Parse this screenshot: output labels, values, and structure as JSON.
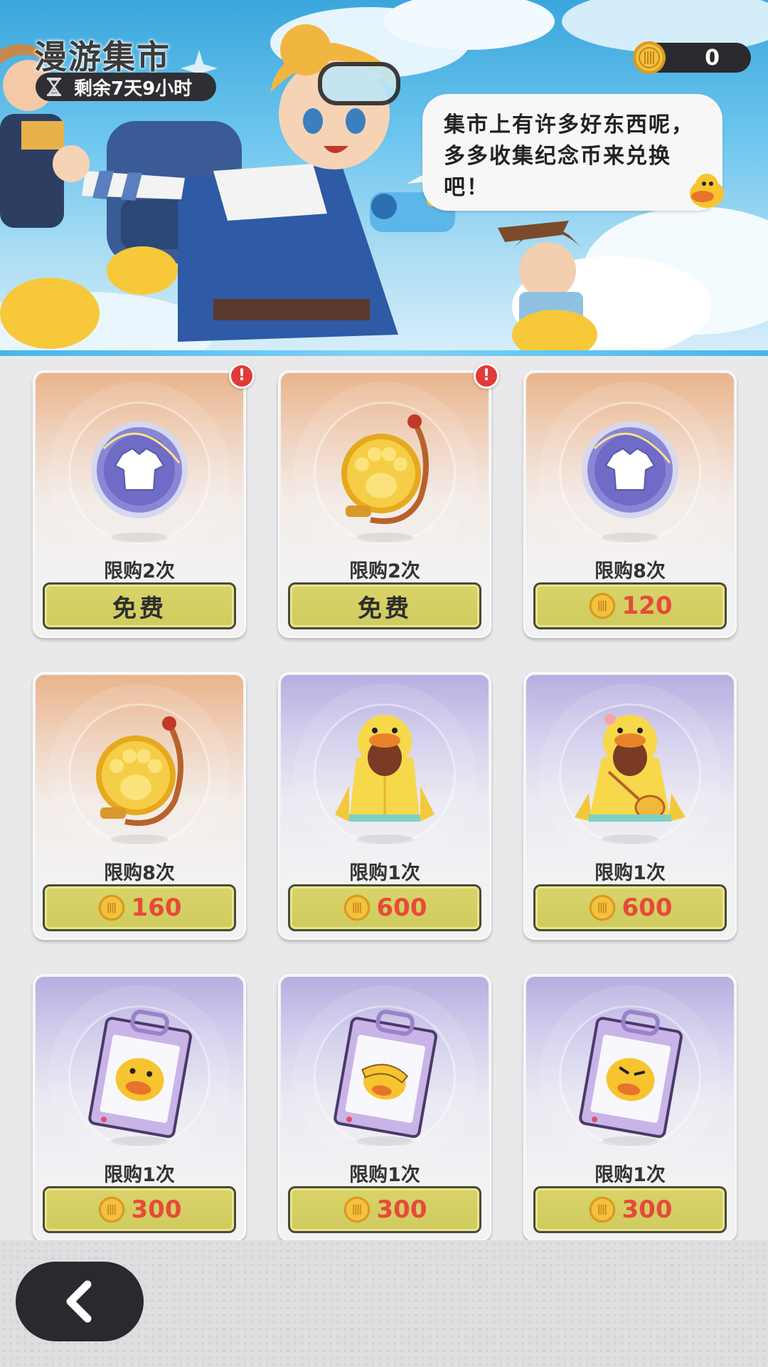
{
  "header": {
    "title": "漫游集市",
    "timer_text": "剩余7天9小时",
    "coin_count": "0",
    "bubble_text": "集市上有许多好东西呢，多多收集纪念币来兑换吧！"
  },
  "colors": {
    "button_bg": "#d8d46a",
    "price_red": "#e64a3a",
    "orange_card": "#e9b48c",
    "purple_card": "#b7aee0",
    "alert_red": "#e23a3a"
  },
  "shop_items": [
    {
      "item_icon": "tshirt-token-icon",
      "limit": "限购2次",
      "price_type": "free",
      "button_label": "免费",
      "alert": "!"
    },
    {
      "item_icon": "paw-medal-icon",
      "limit": "限购2次",
      "price_type": "free",
      "button_label": "免费",
      "alert": "!"
    },
    {
      "item_icon": "tshirt-token-icon",
      "limit": "限购8次",
      "price_type": "coin",
      "button_label": "120"
    },
    {
      "item_icon": "paw-medal-icon",
      "limit": "限购8次",
      "price_type": "coin",
      "button_label": "160"
    },
    {
      "item_icon": "duck-raincoat-icon",
      "limit": "限购1次",
      "price_type": "coin",
      "button_label": "600"
    },
    {
      "item_icon": "duck-raincoat-bag-icon",
      "limit": "限购1次",
      "price_type": "coin",
      "button_label": "600"
    },
    {
      "item_icon": "duck-sticker-pack-icon",
      "limit": "限购1次",
      "price_type": "coin",
      "button_label": "300"
    },
    {
      "item_icon": "duck-sticker-pack-hat-icon",
      "limit": "限购1次",
      "price_type": "coin",
      "button_label": "300"
    },
    {
      "item_icon": "duck-sticker-pack-angry-icon",
      "limit": "限购1次",
      "price_type": "coin",
      "button_label": "300"
    }
  ],
  "nav": {
    "back_icon": "chevron-left-icon"
  }
}
